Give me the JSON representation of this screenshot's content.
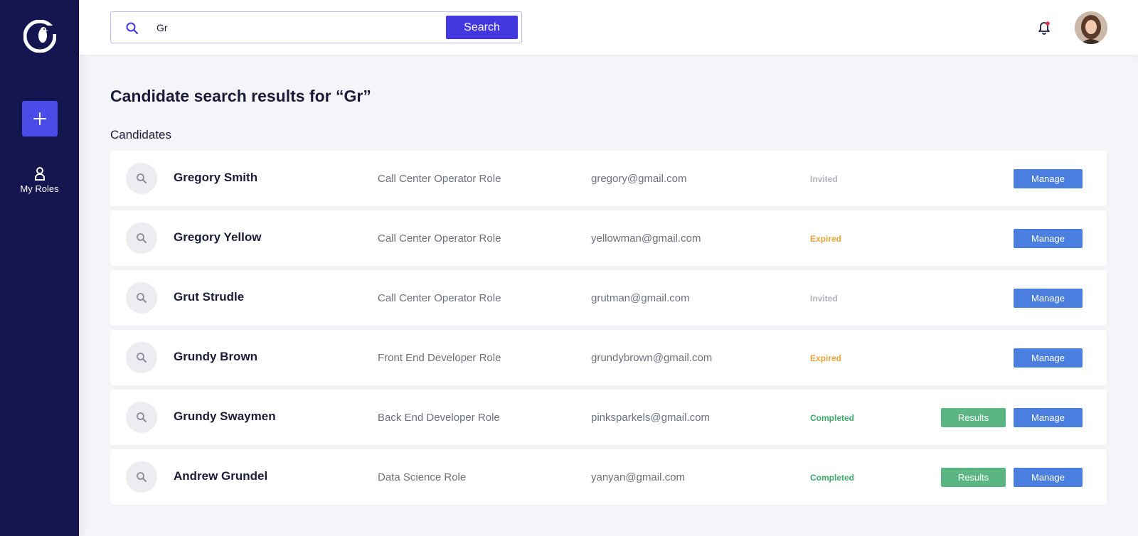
{
  "sidebar": {
    "logo_icon": "penguin-c-logo",
    "add_icon": "plus-icon",
    "nav_roles_icon": "user-icon",
    "nav_roles_label": "My Roles"
  },
  "header": {
    "search_icon": "search-icon",
    "search_value": "Gr",
    "search_button_label": "Search",
    "bell_icon": "bell-icon",
    "avatar_icon": "user-avatar"
  },
  "main": {
    "title": "Candidate search results for “Gr”",
    "section_label": "Candidates",
    "status_colors": {
      "Invited": "#b0b0bc",
      "Expired": "#e8a33d",
      "Completed": "#3ea86b"
    },
    "candidates": [
      {
        "name": "Gregory Smith",
        "role": "Call Center Operator Role",
        "email": "gregory@gmail.com",
        "status": "Invited",
        "results": "",
        "manage": "Manage"
      },
      {
        "name": "Gregory Yellow",
        "role": "Call Center Operator Role",
        "email": "yellowman@gmail.com",
        "status": "Expired",
        "results": "",
        "manage": "Manage"
      },
      {
        "name": "Grut Strudle",
        "role": "Call Center Operator Role",
        "email": "grutman@gmail.com",
        "status": "Invited",
        "results": "",
        "manage": "Manage"
      },
      {
        "name": "Grundy Brown",
        "role": "Front End Developer Role",
        "email": "grundybrown@gmail.com",
        "status": "Expired",
        "results": "",
        "manage": "Manage"
      },
      {
        "name": "Grundy Swaymen",
        "role": "Back End Developer Role",
        "email": "pinksparkels@gmail.com",
        "status": "Completed",
        "results": "Results",
        "manage": "Manage"
      },
      {
        "name": "Andrew Grundel",
        "role": "Data Science Role",
        "email": "yanyan@gmail.com",
        "status": "Completed",
        "results": "Results",
        "manage": "Manage"
      }
    ]
  }
}
